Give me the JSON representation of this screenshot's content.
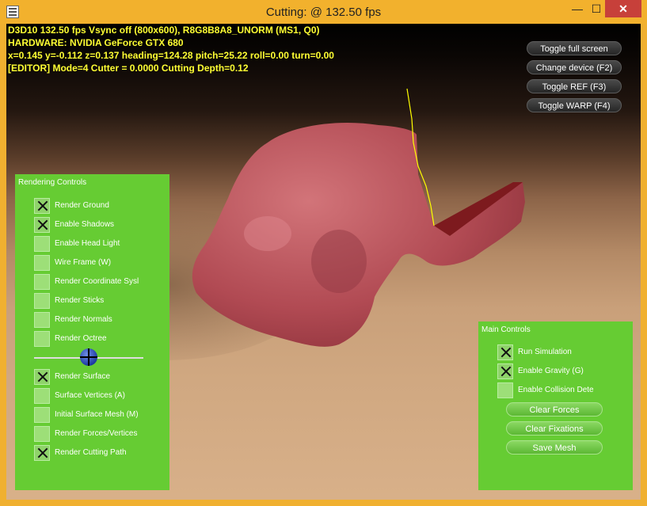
{
  "window": {
    "title": "Cutting: @ 132.50 fps",
    "minimize_glyph": "—",
    "maximize_glyph": "☐",
    "close_glyph": "✕"
  },
  "overlay": {
    "line1": "D3D10 132.50 fps Vsync off (800x600), R8G8B8A8_UNORM (MS1, Q0)",
    "line2": "HARDWARE: NVIDIA GeForce GTX 680",
    "line3": "x=0.145 y=-0.112 z=0.137 heading=124.28 pitch=25.22 roll=0.00 turn=0.00",
    "line4": "[EDITOR] Mode=4 Cutter = 0.0000 Cutting Depth=0.12",
    "text_color": "#ffff33"
  },
  "device_buttons": [
    {
      "label": "Toggle full screen"
    },
    {
      "label": "Change device (F2)"
    },
    {
      "label": "Toggle REF (F3)"
    },
    {
      "label": "Toggle WARP (F4)"
    }
  ],
  "rendering_controls": {
    "title": "Rendering Controls",
    "checkboxes": [
      {
        "label": "Render Ground",
        "checked": true
      },
      {
        "label": "Enable Shadows",
        "checked": true
      },
      {
        "label": "Enable Head Light",
        "checked": false
      },
      {
        "label": "Wire Frame (W)",
        "checked": false
      },
      {
        "label": "Render Coordinate Sysl",
        "checked": false
      },
      {
        "label": "Render Sticks",
        "checked": false
      },
      {
        "label": "Render Normals",
        "checked": false
      },
      {
        "label": "Render Octree",
        "checked": false
      },
      {
        "label": "Render Surface",
        "checked": true
      },
      {
        "label": "Surface Vertices (A)",
        "checked": false
      },
      {
        "label": "Initial Surface Mesh (M)",
        "checked": false
      },
      {
        "label": "Render Forces/Vertices",
        "checked": false
      },
      {
        "label": "Render Cutting Path",
        "checked": true
      }
    ],
    "slider_value": 0.5
  },
  "main_controls": {
    "title": "Main Controls",
    "checkboxes": [
      {
        "label": "Run Simulation",
        "checked": true
      },
      {
        "label": "Enable Gravity (G)",
        "checked": true
      },
      {
        "label": "Enable Collision Dete",
        "checked": false
      }
    ],
    "buttons": [
      {
        "label": "Clear Forces"
      },
      {
        "label": "Clear Fixations"
      },
      {
        "label": "Save Mesh"
      }
    ]
  },
  "colors": {
    "panel_green": "#66cc33",
    "mesh": "#b9545c",
    "cut_face": "#7d1a1e",
    "cutting_path": "#ffff00"
  }
}
